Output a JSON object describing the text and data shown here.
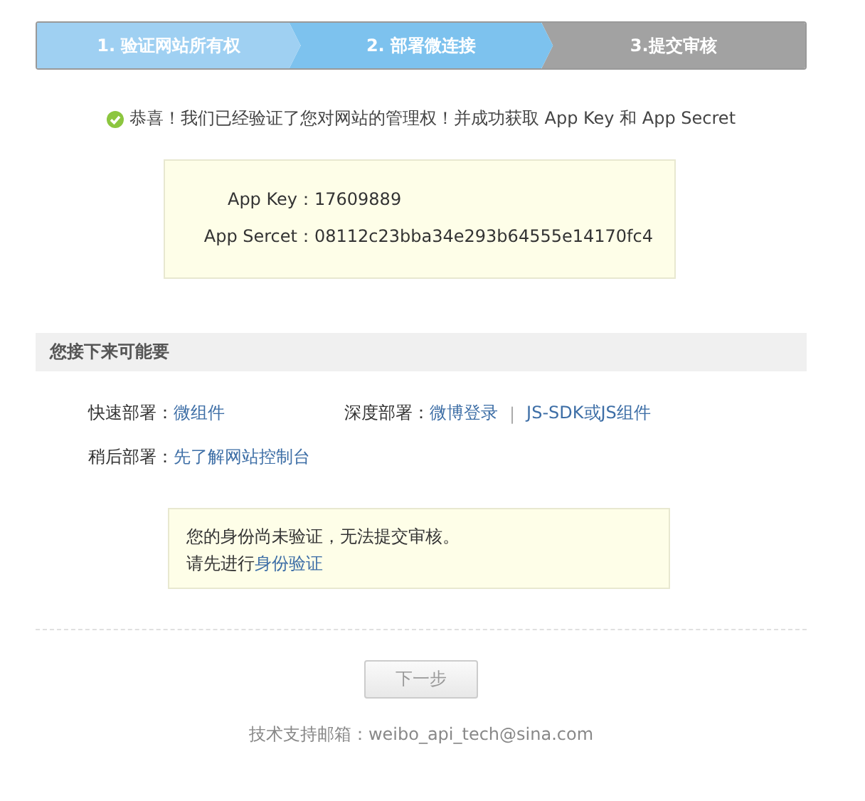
{
  "steps": [
    {
      "label": "1. 验证网站所有权",
      "completed": true,
      "selected": false
    },
    {
      "label": "2. 部署微连接",
      "completed": false,
      "selected": true
    },
    {
      "label": "3.提交审核",
      "completed": false,
      "selected": false
    }
  ],
  "success_message": "恭喜！我们已经验证了您对网站的管理权！并成功获取 App Key 和 App Secret",
  "credentials": [
    {
      "label": "App Key：",
      "value": "17609889"
    },
    {
      "label": "App Sercet：",
      "value": "08112c23bba34e293b64555e14170fc4"
    }
  ],
  "next_section": {
    "title": "您接下来可能要",
    "rows": [
      [
        {
          "label": "快速部署：",
          "links": [
            "微组件"
          ]
        },
        {
          "label": "深度部署：",
          "links": [
            "微博登录",
            "JS-SDK或JS组件"
          ],
          "separator": "|"
        }
      ],
      [
        {
          "label": "稍后部署：",
          "links": [
            "先了解网站控制台"
          ]
        }
      ]
    ]
  },
  "notice": {
    "text": "您的身份尚未验证，无法提交审核。",
    "prompt": "请先进行",
    "link": "身份验证"
  },
  "next_button": {
    "label": "下一步",
    "disabled": true
  },
  "footer": "技术支持邮箱：weibo_api_tech@sina.com"
}
